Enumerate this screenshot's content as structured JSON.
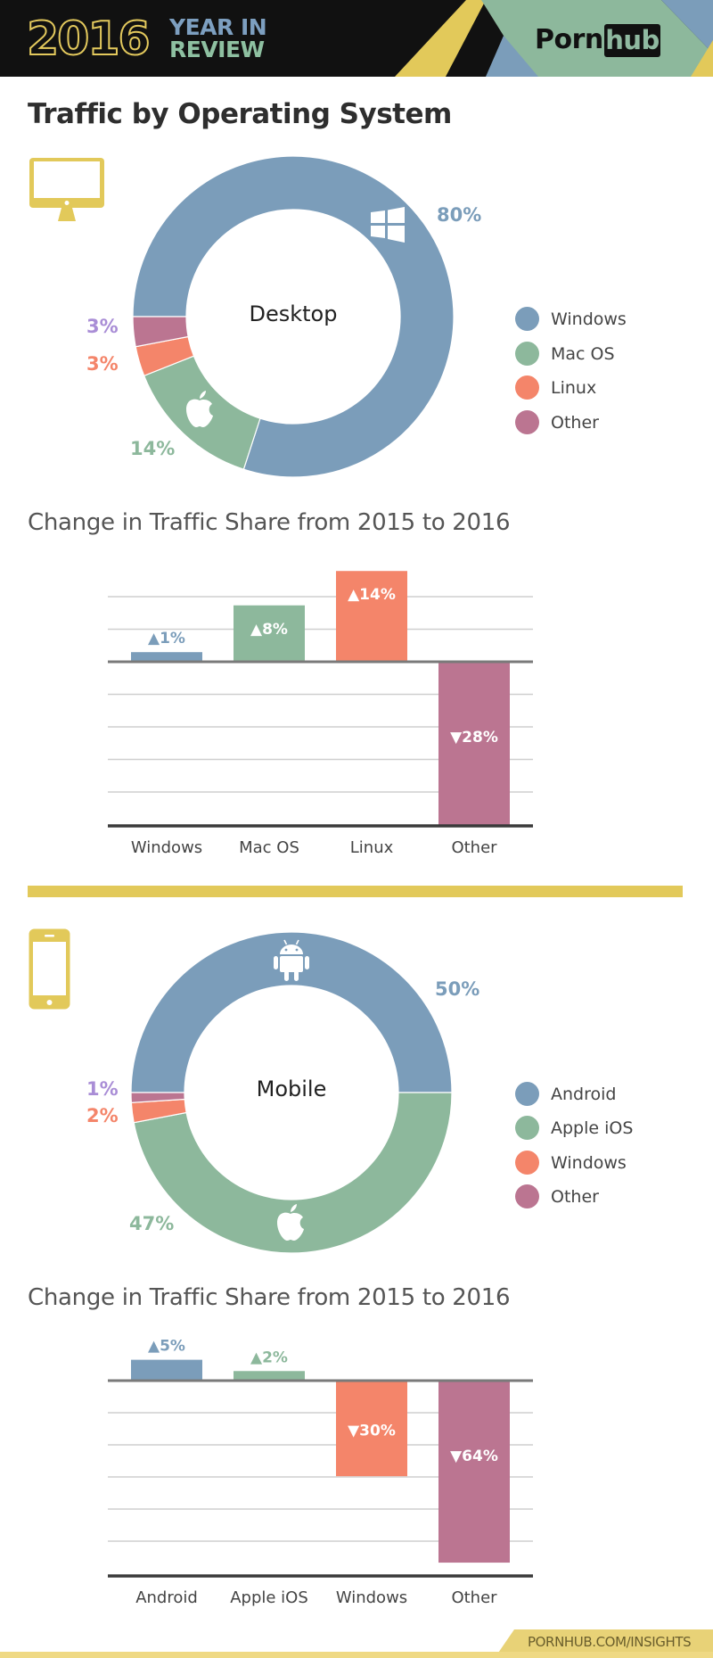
{
  "header": {
    "year": "2016",
    "line1": "YEAR IN",
    "line2": "REVIEW",
    "logo_left": "Porn",
    "logo_right": "hub"
  },
  "page_title": "Traffic by Operating System",
  "colors": {
    "blue": "#7b9dba",
    "green": "#8db89c",
    "orange": "#f4856a",
    "mauve": "#bb7591",
    "yellow": "#e2c95a",
    "lavender": "#a98dd6",
    "black": "#111111"
  },
  "desktop": {
    "device_icon": "desktop-monitor-icon",
    "center_label": "Desktop",
    "legend": [
      {
        "label": "Windows",
        "color": "#7b9dba"
      },
      {
        "label": "Mac OS",
        "color": "#8db89c"
      },
      {
        "label": "Linux",
        "color": "#f4856a"
      },
      {
        "label": "Other",
        "color": "#bb7591"
      }
    ],
    "pct_labels": {
      "windows": "80%",
      "macos": "14%",
      "linux": "3%",
      "other": "3%"
    },
    "change_title": "Change in Traffic Share from 2015 to 2016",
    "bar_labels": [
      "▲1%",
      "▲8%",
      "▲14%",
      "▼28%"
    ],
    "categories": [
      "Windows",
      "Mac OS",
      "Linux",
      "Other"
    ]
  },
  "mobile": {
    "device_icon": "smartphone-icon",
    "center_label": "Mobile",
    "legend": [
      {
        "label": "Android",
        "color": "#7b9dba"
      },
      {
        "label": "Apple iOS",
        "color": "#8db89c"
      },
      {
        "label": "Windows",
        "color": "#f4856a"
      },
      {
        "label": "Other",
        "color": "#bb7591"
      }
    ],
    "pct_labels": {
      "android": "50%",
      "ios": "47%",
      "windows": "2%",
      "other": "1%"
    },
    "change_title": "Change in Traffic Share from 2015 to 2016",
    "bar_labels": [
      "▲5%",
      "▲2%",
      "▼30%",
      "▼64%"
    ],
    "categories": [
      "Android",
      "Apple iOS",
      "Windows",
      "Other"
    ]
  },
  "footer": {
    "text": "PORNHUB.COM/INSIGHTS"
  },
  "chart_data": [
    {
      "type": "pie",
      "title": "Desktop",
      "categories": [
        "Windows",
        "Mac OS",
        "Linux",
        "Other"
      ],
      "values": [
        80,
        14,
        3,
        3
      ],
      "unit": "%",
      "colors": [
        "#7b9dba",
        "#8db89c",
        "#f4856a",
        "#bb7591"
      ],
      "donut": true,
      "legend": "right"
    },
    {
      "type": "bar",
      "title": "Change in Traffic Share from 2015 to 2016",
      "categories": [
        "Windows",
        "Mac OS",
        "Linux",
        "Other"
      ],
      "values": [
        1,
        8,
        14,
        -28
      ],
      "unit": "%",
      "colors": [
        "#7b9dba",
        "#8db89c",
        "#f4856a",
        "#bb7591"
      ],
      "xlabel": "",
      "ylabel": "",
      "grid": true
    },
    {
      "type": "pie",
      "title": "Mobile",
      "categories": [
        "Android",
        "Apple iOS",
        "Windows",
        "Other"
      ],
      "values": [
        50,
        47,
        2,
        1
      ],
      "unit": "%",
      "colors": [
        "#7b9dba",
        "#8db89c",
        "#f4856a",
        "#bb7591"
      ],
      "donut": true,
      "legend": "right"
    },
    {
      "type": "bar",
      "title": "Change in Traffic Share from 2015 to 2016",
      "categories": [
        "Android",
        "Apple iOS",
        "Windows",
        "Other"
      ],
      "values": [
        5,
        2,
        -30,
        -64
      ],
      "unit": "%",
      "colors": [
        "#7b9dba",
        "#8db89c",
        "#f4856a",
        "#bb7591"
      ],
      "xlabel": "",
      "ylabel": "",
      "grid": true
    }
  ]
}
